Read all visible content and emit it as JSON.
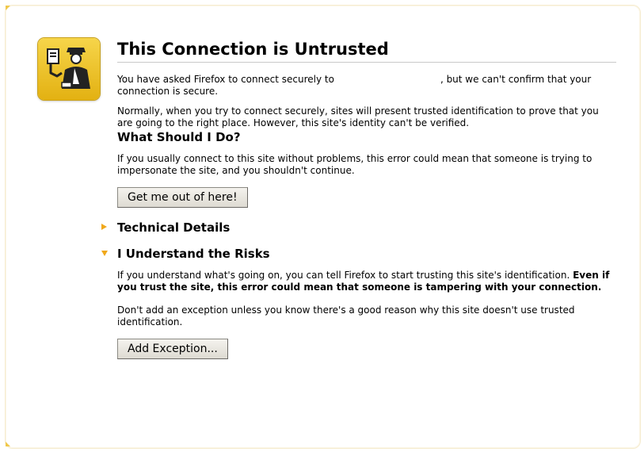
{
  "page": {
    "title": "This Connection is Untrusted",
    "intro_before": "You have asked Firefox to connect securely to",
    "intro_after": ", but we can't confirm that your connection is secure.",
    "normally": "Normally, when you try to connect securely, sites will present trusted identification to prove that you are going to the right place. However, this site's identity can't be verified."
  },
  "what_to_do": {
    "heading": "What Should I Do?",
    "text": "If you usually connect to this site without problems, this error could mean that someone is trying to impersonate the site, and you shouldn't continue.",
    "button": "Get me out of here!"
  },
  "technical": {
    "heading": "Technical Details",
    "expanded": false
  },
  "risks": {
    "heading": "I Understand the Risks",
    "expanded": true,
    "text_plain": "If you understand what's going on, you can tell Firefox to start trusting this site's identification.",
    "text_bold": "Even if you trust the site, this error could mean that someone is tampering with your connection.",
    "advice": "Don't add an exception unless you know there's a good reason why this site doesn't use trusted identification.",
    "button": "Add Exception..."
  },
  "icons": {
    "certificate": "police-officer-certificate-icon",
    "tech_twisty": "triangle-right-icon",
    "risks_twisty": "triangle-down-icon"
  },
  "colors": {
    "accent": "#f0a81b",
    "icon_bg": "#e8bc1e"
  }
}
